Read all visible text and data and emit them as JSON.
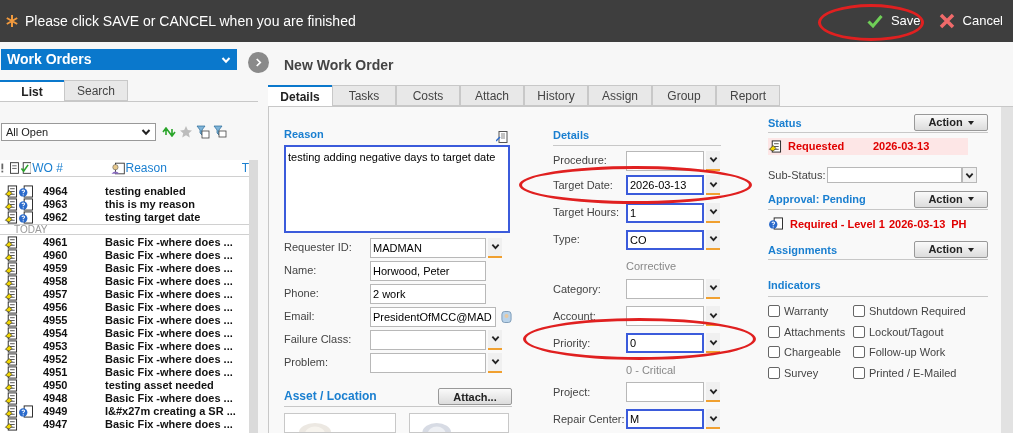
{
  "banner": {
    "message": "Please click SAVE or CANCEL when you are finished",
    "buttons": [
      {
        "label": "Save",
        "kind": "save"
      },
      {
        "label": "Cancel",
        "kind": "cancel"
      }
    ]
  },
  "sidebar": {
    "title": "Work Orders",
    "tabs": [
      {
        "label": "List",
        "selected": true
      },
      {
        "label": "Search",
        "selected": false
      }
    ],
    "filter": {
      "value": "All Open"
    },
    "columns": [
      "WO #",
      "Reason",
      "T"
    ],
    "rows": [
      {
        "kind": "row",
        "wo": "4964",
        "reason": "testing enabled",
        "approval": true
      },
      {
        "kind": "row",
        "wo": "4963",
        "reason": "this is my reason",
        "approval": true
      },
      {
        "kind": "row",
        "wo": "4962",
        "reason": "testing target date",
        "approval": true
      },
      {
        "kind": "divider",
        "label": "TODAY"
      },
      {
        "kind": "row",
        "wo": "4961",
        "reason": "Basic Fix -where does ...",
        "approval": false
      },
      {
        "kind": "row",
        "wo": "4960",
        "reason": "Basic Fix -where does ...",
        "approval": false
      },
      {
        "kind": "row",
        "wo": "4959",
        "reason": "Basic Fix -where does ...",
        "approval": false
      },
      {
        "kind": "row",
        "wo": "4958",
        "reason": "Basic Fix -where does ...",
        "approval": false
      },
      {
        "kind": "row",
        "wo": "4957",
        "reason": "Basic Fix -where does ...",
        "approval": false
      },
      {
        "kind": "row",
        "wo": "4956",
        "reason": "Basic Fix -where does ...",
        "approval": false
      },
      {
        "kind": "row",
        "wo": "4955",
        "reason": "Basic Fix -where does ...",
        "approval": false
      },
      {
        "kind": "row",
        "wo": "4954",
        "reason": "Basic Fix -where does ...",
        "approval": false
      },
      {
        "kind": "row",
        "wo": "4953",
        "reason": "Basic Fix -where does ...",
        "approval": false
      },
      {
        "kind": "row",
        "wo": "4952",
        "reason": "Basic Fix -where does ...",
        "approval": false
      },
      {
        "kind": "row",
        "wo": "4951",
        "reason": "Basic Fix -where does ...",
        "approval": false
      },
      {
        "kind": "row",
        "wo": "4950",
        "reason": "testing asset needed",
        "approval": false
      },
      {
        "kind": "row",
        "wo": "4948",
        "reason": "Basic Fix -where does ...",
        "approval": false
      },
      {
        "kind": "row",
        "wo": "4949",
        "reason": "I&#x27m creating a SR ...",
        "approval": true
      },
      {
        "kind": "row",
        "wo": "4947",
        "reason": "Basic Fix -where does ...",
        "approval": false
      }
    ]
  },
  "work_order": {
    "title": "New Work Order",
    "tabs": [
      {
        "label": "Details",
        "selected": true
      },
      {
        "label": "Tasks",
        "selected": false
      },
      {
        "label": "Costs",
        "selected": false
      },
      {
        "label": "Attach",
        "selected": false
      },
      {
        "label": "History",
        "selected": false
      },
      {
        "label": "Assign",
        "selected": false
      },
      {
        "label": "Group",
        "selected": false
      },
      {
        "label": "Report",
        "selected": false
      }
    ],
    "reason": {
      "label": "Reason",
      "value": "testing adding negative days to target date"
    },
    "requester_fields": [
      {
        "label": "Requester ID:",
        "value": "MADMAN",
        "kind": "select"
      },
      {
        "label": "Name:",
        "value": "Horwood, Peter",
        "kind": "text"
      },
      {
        "label": "Phone:",
        "value": "2 work",
        "kind": "text"
      },
      {
        "label": "Email:",
        "value": "PresidentOfMCC@MAD",
        "kind": "email"
      },
      {
        "label": "Failure Class:",
        "kind": "select"
      },
      {
        "label": "Problem:",
        "kind": "select"
      }
    ],
    "asset": {
      "title": "Asset / Location",
      "button": "Attach..."
    },
    "details": {
      "title": "Details",
      "fields": [
        {
          "kind": "select",
          "label": "Procedure:",
          "highlighted": false
        },
        {
          "kind": "select",
          "label": "Target Date:",
          "value": "2026-03-13",
          "highlighted": true
        },
        {
          "kind": "select",
          "label": "Target Hours:",
          "value": "1",
          "highlighted": true
        },
        {
          "kind": "select",
          "label": "Type:",
          "value": "CO",
          "highlighted": true
        },
        {
          "kind": "note",
          "text": "Corrective"
        },
        {
          "kind": "select",
          "label": "Category:",
          "highlighted": false
        },
        {
          "kind": "select",
          "label": "Account:",
          "highlighted": false
        },
        {
          "kind": "select",
          "label": "Priority:",
          "value": "0",
          "highlighted": true
        },
        {
          "kind": "note",
          "text": "0 - Critical"
        },
        {
          "kind": "select",
          "label": "Project:",
          "highlighted": false
        },
        {
          "kind": "select",
          "label": "Repair Center:",
          "value": "M",
          "highlighted": true
        }
      ]
    },
    "status": {
      "title": "Status",
      "action": "Action",
      "state": "Requested",
      "date": "2026-03-13",
      "sub_status_label": "Sub-Status:"
    },
    "approval": {
      "title": "Approval: Pending",
      "action": "Action",
      "level": "Required - Level 1",
      "date": "2026-03-13",
      "by": "PH"
    },
    "assignments": {
      "title": "Assignments",
      "action": "Action"
    },
    "indicators": {
      "title": "Indicators",
      "items": [
        {
          "label": "Warranty",
          "checked": false
        },
        {
          "label": "Shutdown Required",
          "checked": false
        },
        {
          "label": "Attachments",
          "checked": false
        },
        {
          "label": "Lockout/Tagout",
          "checked": false
        },
        {
          "label": "Chargeable",
          "checked": false
        },
        {
          "label": "Follow-up Work",
          "checked": false
        },
        {
          "label": "Survey",
          "checked": false
        },
        {
          "label": "Printed / E-Mailed",
          "checked": false
        }
      ]
    }
  }
}
